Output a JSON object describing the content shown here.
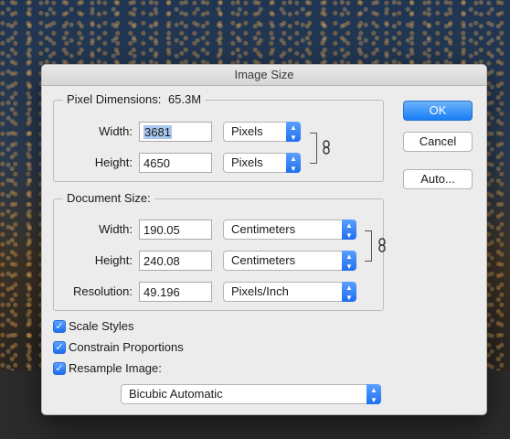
{
  "dialog": {
    "title": "Image Size"
  },
  "pixel_dimensions": {
    "legend": "Pixel Dimensions:",
    "size": "65.3M",
    "width": {
      "label": "Width:",
      "value": "3681",
      "unit": "Pixels"
    },
    "height": {
      "label": "Height:",
      "value": "4650",
      "unit": "Pixels"
    }
  },
  "document_size": {
    "legend": "Document Size:",
    "width": {
      "label": "Width:",
      "value": "190.05",
      "unit": "Centimeters"
    },
    "height": {
      "label": "Height:",
      "value": "240.08",
      "unit": "Centimeters"
    },
    "resolution": {
      "label": "Resolution:",
      "value": "49.196",
      "unit": "Pixels/Inch"
    }
  },
  "options": {
    "scale_styles": {
      "label": "Scale Styles",
      "checked": true
    },
    "constrain_proportions": {
      "label": "Constrain Proportions",
      "checked": true
    },
    "resample_image": {
      "label": "Resample Image:",
      "checked": true
    },
    "resample_method": "Bicubic Automatic"
  },
  "buttons": {
    "ok": "OK",
    "cancel": "Cancel",
    "auto": "Auto..."
  },
  "colors": {
    "accent": "#1e6ff0",
    "dialog_bg": "#ececec"
  },
  "icons": {
    "link": "chain-link-icon",
    "stepper": "up-down-stepper-icon",
    "check": "checkmark-icon"
  }
}
